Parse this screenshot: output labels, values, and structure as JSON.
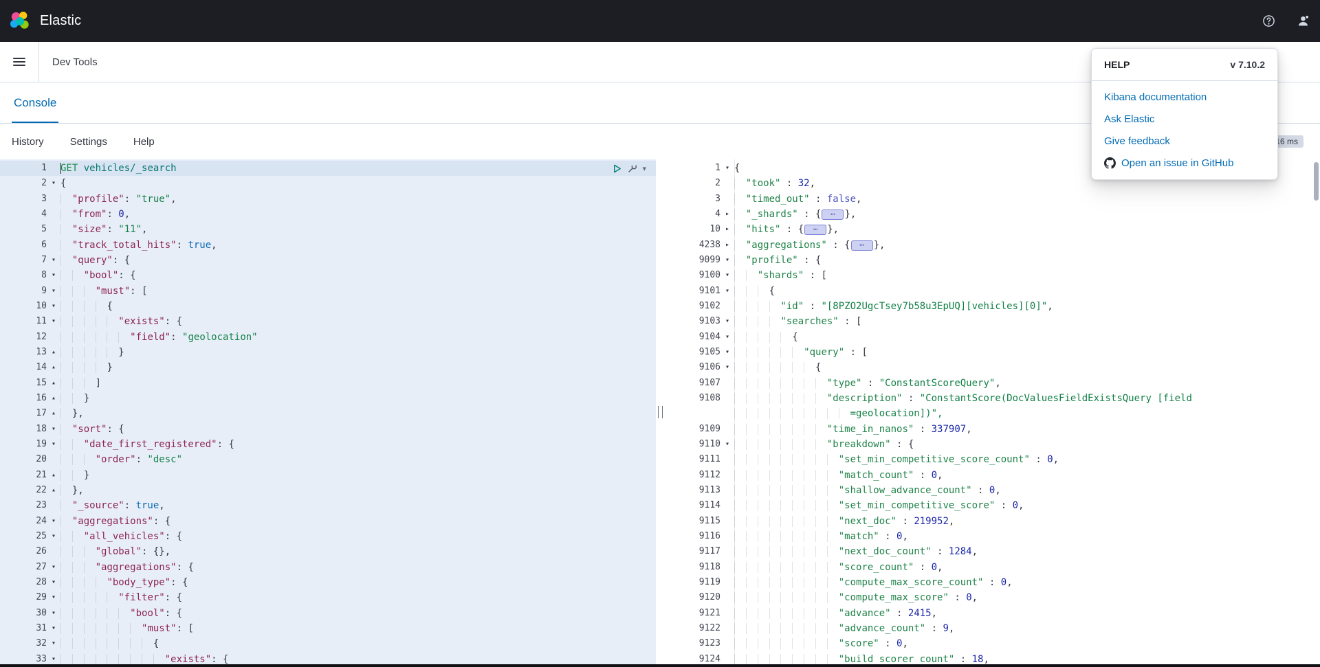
{
  "header": {
    "brand": "Elastic"
  },
  "nav": {
    "breadcrumb": "Dev Tools"
  },
  "tabs": {
    "console": "Console"
  },
  "menu": {
    "items": [
      "History",
      "Settings",
      "Help"
    ]
  },
  "response": {
    "time_badge": "16 ms"
  },
  "help_popover": {
    "title": "HELP",
    "version": "v 7.10.2",
    "links": [
      "Kibana documentation",
      "Ask Elastic",
      "Give feedback",
      "Open an issue in GitHub"
    ]
  },
  "colors": {
    "accent": "#006bb4",
    "header_bg": "#1d1e24",
    "request_editor_bg": "#e8eef8",
    "link": "#006bb4"
  },
  "request_editor": {
    "lines": [
      {
        "n": "1",
        "t": "GET vehicles/_search",
        "a": true,
        "cur": true
      },
      {
        "n": "2",
        "w": "open",
        "t": "{"
      },
      {
        "n": "3",
        "t": "  \"profile\": \"true\","
      },
      {
        "n": "4",
        "t": "  \"from\": 0,"
      },
      {
        "n": "5",
        "t": "  \"size\": \"11\","
      },
      {
        "n": "6",
        "t": "  \"track_total_hits\": true,"
      },
      {
        "n": "7",
        "w": "open",
        "t": "  \"query\": {"
      },
      {
        "n": "8",
        "w": "open",
        "t": "    \"bool\": {"
      },
      {
        "n": "9",
        "w": "open",
        "t": "      \"must\": ["
      },
      {
        "n": "10",
        "w": "open",
        "t": "        {"
      },
      {
        "n": "11",
        "w": "open",
        "t": "          \"exists\": {"
      },
      {
        "n": "12",
        "t": "            \"field\": \"geolocation\""
      },
      {
        "n": "13",
        "w": "close",
        "t": "          }"
      },
      {
        "n": "14",
        "w": "close",
        "t": "        }"
      },
      {
        "n": "15",
        "w": "close",
        "t": "      ]"
      },
      {
        "n": "16",
        "w": "close",
        "t": "    }"
      },
      {
        "n": "17",
        "w": "close",
        "t": "  },"
      },
      {
        "n": "18",
        "w": "open",
        "t": "  \"sort\": {"
      },
      {
        "n": "19",
        "w": "open",
        "t": "    \"date_first_registered\": {"
      },
      {
        "n": "20",
        "t": "      \"order\": \"desc\""
      },
      {
        "n": "21",
        "w": "close",
        "t": "    }"
      },
      {
        "n": "22",
        "w": "close",
        "t": "  },"
      },
      {
        "n": "23",
        "t": "  \"_source\": true,"
      },
      {
        "n": "24",
        "w": "open",
        "t": "  \"aggregations\": {"
      },
      {
        "n": "25",
        "w": "open",
        "t": "    \"all_vehicles\": {"
      },
      {
        "n": "26",
        "t": "      \"global\": {},"
      },
      {
        "n": "27",
        "w": "open",
        "t": "      \"aggregations\": {"
      },
      {
        "n": "28",
        "w": "open",
        "t": "        \"body_type\": {"
      },
      {
        "n": "29",
        "w": "open",
        "t": "          \"filter\": {"
      },
      {
        "n": "30",
        "w": "open",
        "t": "            \"bool\": {"
      },
      {
        "n": "31",
        "w": "open",
        "t": "              \"must\": ["
      },
      {
        "n": "32",
        "w": "open",
        "t": "                {"
      },
      {
        "n": "33",
        "w": "open",
        "t": "                  \"exists\": {"
      }
    ]
  },
  "response_editor": {
    "lines": [
      {
        "n": "1",
        "w": "open",
        "t": "{"
      },
      {
        "n": "2",
        "t": "  \"took\" : 32,"
      },
      {
        "n": "3",
        "t": "  \"timed_out\" : false,"
      },
      {
        "n": "4",
        "w": "closed",
        "pre": "  \"_shards\" : {",
        "post": "},"
      },
      {
        "n": "10",
        "w": "closed",
        "pre": "  \"hits\" : {",
        "post": "},"
      },
      {
        "n": "4238",
        "w": "closed",
        "pre": "  \"aggregations\" : {",
        "post": "},"
      },
      {
        "n": "9099",
        "w": "open",
        "t": "  \"profile\" : {"
      },
      {
        "n": "9100",
        "w": "open",
        "t": "    \"shards\" : ["
      },
      {
        "n": "9101",
        "w": "open",
        "t": "      {"
      },
      {
        "n": "9102",
        "t": "        \"id\" : \"[8PZO2UgcTsey7b58u3EpUQ][vehicles][0]\","
      },
      {
        "n": "9103",
        "w": "open",
        "t": "        \"searches\" : ["
      },
      {
        "n": "9104",
        "w": "open",
        "t": "          {"
      },
      {
        "n": "9105",
        "w": "open",
        "t": "            \"query\" : ["
      },
      {
        "n": "9106",
        "w": "open",
        "t": "              {"
      },
      {
        "n": "9107",
        "t": "                \"type\" : \"ConstantScoreQuery\","
      },
      {
        "n": "9108",
        "t": "                \"description\" : \"ConstantScore(DocValuesFieldExistsQuery [field"
      },
      {
        "n": "",
        "t": "                    =geolocation])\",",
        "cls": "t-str"
      },
      {
        "n": "9109",
        "t": "                \"time_in_nanos\" : 337907,"
      },
      {
        "n": "9110",
        "w": "open",
        "t": "                \"breakdown\" : {"
      },
      {
        "n": "9111",
        "t": "                  \"set_min_competitive_score_count\" : 0,"
      },
      {
        "n": "9112",
        "t": "                  \"match_count\" : 0,"
      },
      {
        "n": "9113",
        "t": "                  \"shallow_advance_count\" : 0,"
      },
      {
        "n": "9114",
        "t": "                  \"set_min_competitive_score\" : 0,"
      },
      {
        "n": "9115",
        "t": "                  \"next_doc\" : 219952,"
      },
      {
        "n": "9116",
        "t": "                  \"match\" : 0,"
      },
      {
        "n": "9117",
        "t": "                  \"next_doc_count\" : 1284,"
      },
      {
        "n": "9118",
        "t": "                  \"score_count\" : 0,"
      },
      {
        "n": "9119",
        "t": "                  \"compute_max_score_count\" : 0,"
      },
      {
        "n": "9120",
        "t": "                  \"compute_max_score\" : 0,"
      },
      {
        "n": "9121",
        "t": "                  \"advance\" : 2415,"
      },
      {
        "n": "9122",
        "t": "                  \"advance_count\" : 9,"
      },
      {
        "n": "9123",
        "t": "                  \"score\" : 0,"
      },
      {
        "n": "9124",
        "t": "                  \"build_scorer_count\" : 18,"
      }
    ]
  }
}
